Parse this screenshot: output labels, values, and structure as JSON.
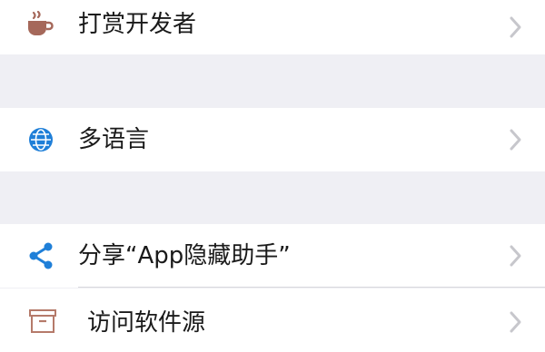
{
  "rows": [
    {
      "label": "打赏开发者",
      "icon": "coffee-cup-icon"
    },
    {
      "label": "多语言",
      "icon": "globe-icon"
    },
    {
      "label": "分享“App隐藏助手”",
      "icon": "share-icon"
    },
    {
      "label": "访问软件源",
      "icon": "archive-box-icon"
    }
  ],
  "colors": {
    "background": "#efeff4",
    "row": "#ffffff",
    "coffee": "#a5685a",
    "globe": "#1f7fd8",
    "share": "#1f7fd8",
    "archive": "#b57a6a",
    "chevron": "#c7c7cc"
  }
}
